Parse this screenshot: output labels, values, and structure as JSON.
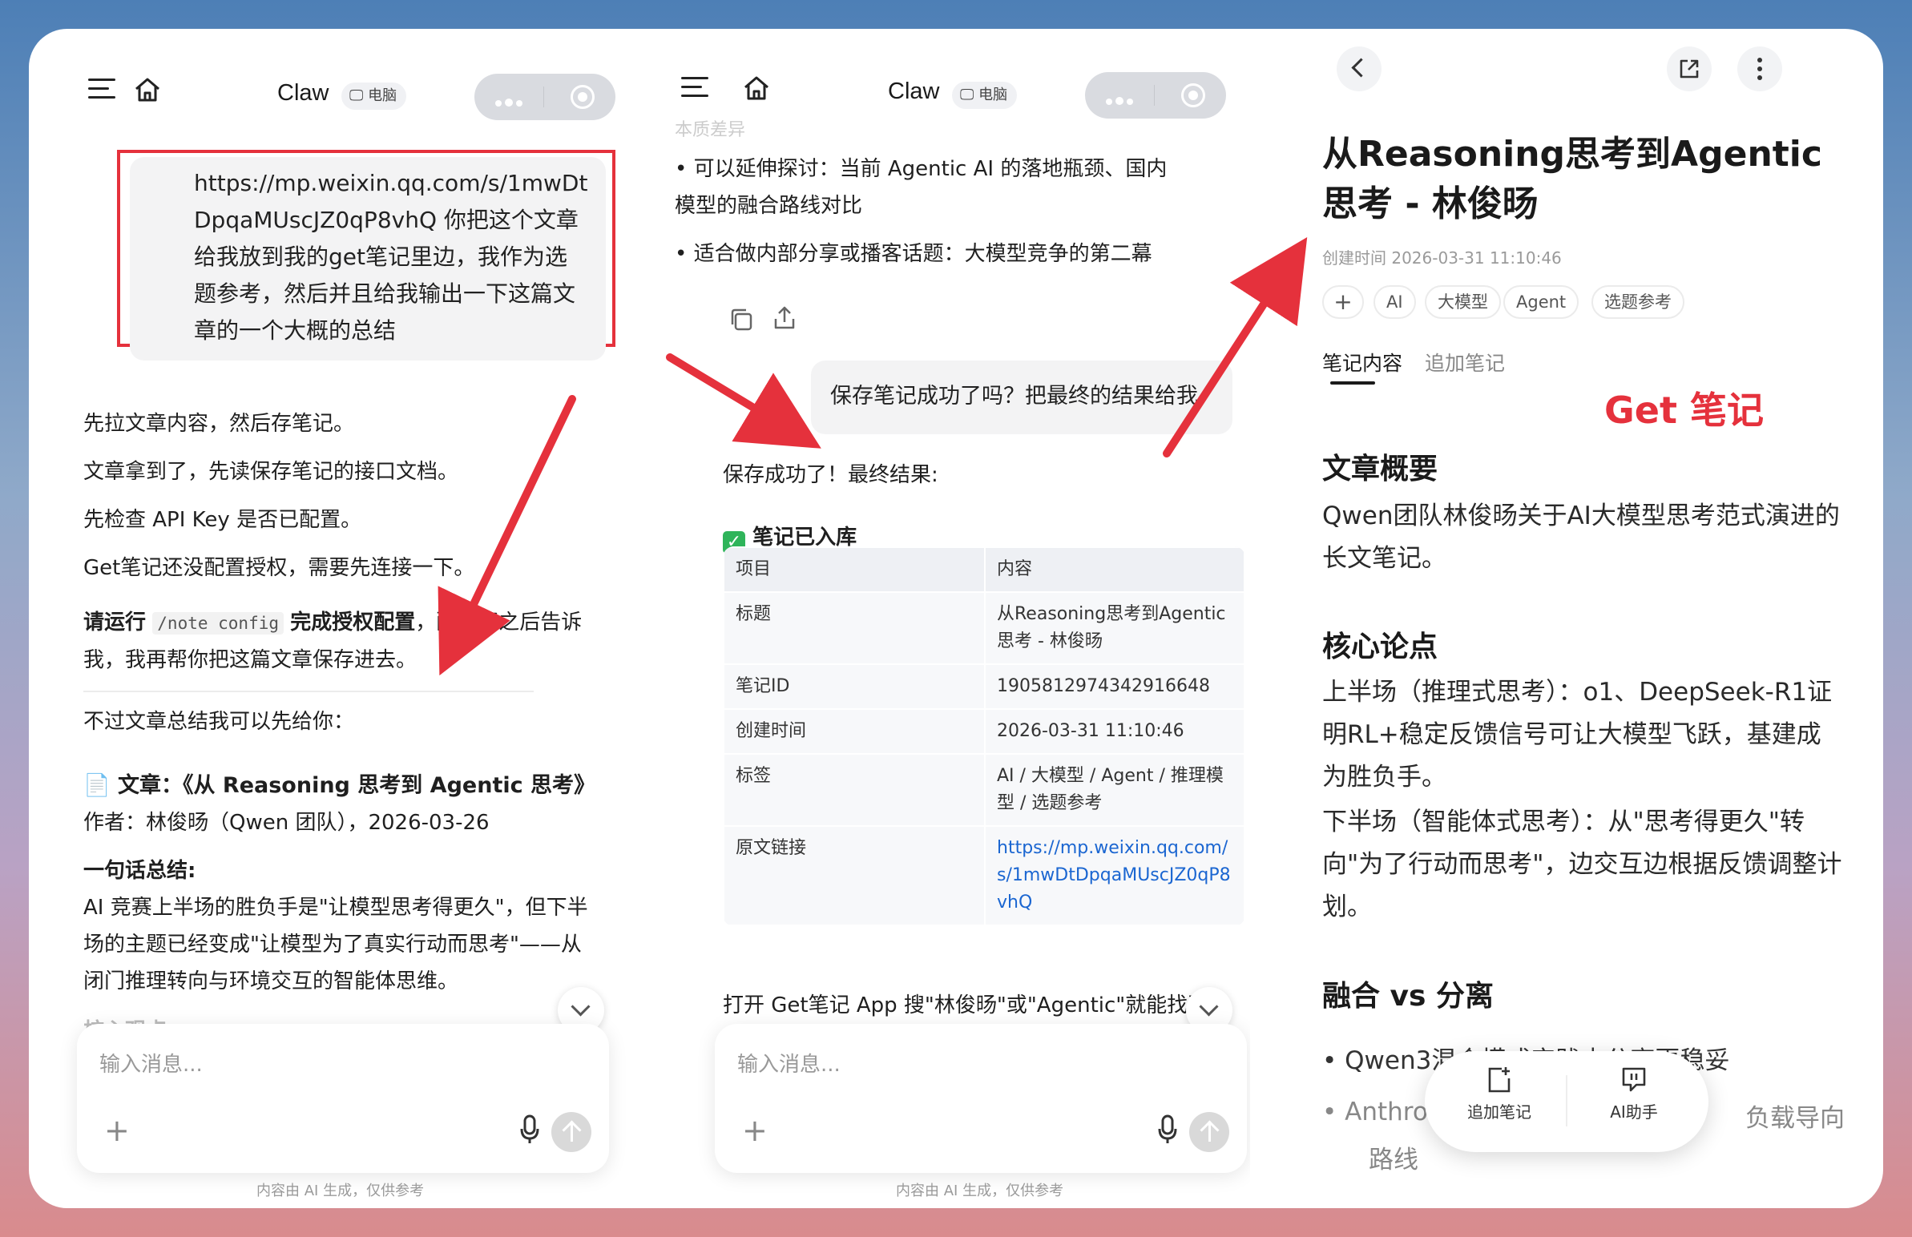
{
  "header": {
    "title": "Claw",
    "badge": "电脑"
  },
  "panel1": {
    "user_message": "https://mp.weixin.qq.com/s/1mwDtDpqaMUscJZ0qP8vhQ 你把这个文章给我放到我的get笔记里边，我作为选题参考，然后并且给我输出一下这篇文章的一个大概的总结",
    "line1": "先拉文章内容，然后存笔记。",
    "line2": "文章拿到了，先读保存笔记的接口文档。",
    "line3": "先检查 API Key 是否已配置。",
    "line4": "Get笔记还没配置授权，需要先连接一下。",
    "line5_a": "请运行",
    "line5_code": "/note config",
    "line5_b": "完成授权配置",
    "line5_c": "，配置好之后告诉",
    "line5_d": "我，我再帮你把这篇文章保存进去。",
    "line6": "不过文章总结我可以先给你：",
    "article_label": "📄 文章：《从 Reasoning 思考到 Agentic 思考》",
    "author_line": "作者：林俊旸（Qwen 团队），2026-03-26",
    "summary_title": "一句话总结:",
    "summary_l1": "AI 竞赛上半场的胜负手是\"让模型思考得更久\"，但下半",
    "summary_l2": "场的主题已经变成\"让模型为了真实行动而思考\"——从",
    "summary_l3": "闭门推理转向与环境交互的智能体思维。",
    "core_label": "核心观点:"
  },
  "panel2": {
    "top_fade": "本质差异",
    "bullet1_l1": "• 可以延伸探讨：当前 Agentic AI 的落地瓶颈、国内",
    "bullet1_l2": "模型的融合路线对比",
    "bullet2": "• 适合做内部分享或播客话题：大模型竞争的第二幕",
    "user_message": "保存笔记成功了吗？把最终的结果给我",
    "reply": "保存成功了！最终结果:",
    "status": "笔记已入库",
    "table": {
      "headers": [
        "项目",
        "内容"
      ],
      "rows": [
        [
          "标题",
          "从Reasoning思考到Agentic思考 - 林俊旸"
        ],
        [
          "笔记ID",
          "1905812974342916648"
        ],
        [
          "创建时间",
          "2026-03-31 11:10:46"
        ],
        [
          "标签",
          "AI / 大模型 / Agent / 推理模型 / 选题参考"
        ],
        [
          "原文链接",
          "https://mp.weixin.qq.com/s/1mwDtDpqaMUscJZ0qP8vhQ"
        ]
      ]
    },
    "footer_text": "打开 Get笔记 App 搜\"林俊旸\"或\"Agentic\"就能找到。"
  },
  "input": {
    "placeholder": "输入消息...",
    "disclaimer": "内容由 AI 生成，仅供参考"
  },
  "panel3": {
    "title": "从Reasoning思考到Agentic思考 - 林俊旸",
    "created_label": "创建时间",
    "created_value": "2026-03-31 11:10:46",
    "tags": [
      "AI",
      "大模型",
      "Agent",
      "选题参考"
    ],
    "tab_content": "笔记内容",
    "tab_append": "追加笔记",
    "annotation": "Get 笔记",
    "section1": "文章概要",
    "summary": "Qwen团队林俊旸关于AI大模型思考范式演进的长文笔记。",
    "section2": "核心论点",
    "point1": "上半场（推理式思考）：o1、DeepSeek-R1证明RL+稳定反馈信号可让大模型飞跃，基建成为胜负手。",
    "point2": "下半场（智能体式思考）：从\"思考得更久\"转向\"为了行动而思考\"，边交互边根据反馈调整计划。",
    "section3": "融合 vs 分离",
    "bullet1": "• Qwen3混合模式实践中分离更稳妥",
    "bullet2_a": "• Anthro",
    "bullet2_b": "负载导向",
    "bullet2_c": "路线",
    "float_append": "追加笔记",
    "float_ai": "AI助手"
  },
  "colors": {
    "accent_red": "#e5313c",
    "link_blue": "#1b66d1"
  }
}
